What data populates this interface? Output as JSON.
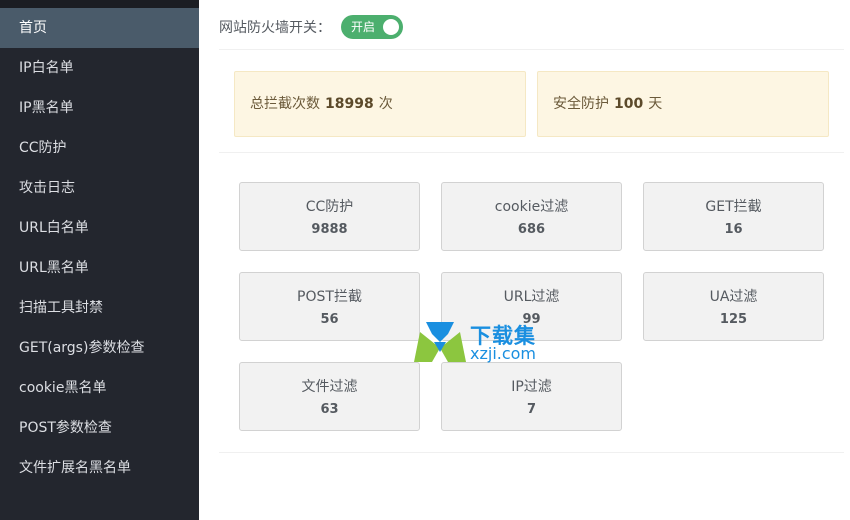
{
  "sidebar": {
    "items": [
      {
        "label": "首页",
        "active": true
      },
      {
        "label": "IP白名单"
      },
      {
        "label": "IP黑名单"
      },
      {
        "label": "CC防护"
      },
      {
        "label": "攻击日志"
      },
      {
        "label": "URL白名单"
      },
      {
        "label": "URL黑名单"
      },
      {
        "label": "扫描工具封禁"
      },
      {
        "label": "GET(args)参数检查"
      },
      {
        "label": "cookie黑名单"
      },
      {
        "label": "POST参数检查"
      },
      {
        "label": "文件扩展名黑名单"
      }
    ]
  },
  "firewall": {
    "label": "网站防火墙开关：",
    "toggle_text": "开启",
    "enabled": true
  },
  "stats": {
    "blocked_prefix": "总拦截次数",
    "blocked_count": "18998",
    "blocked_suffix": "次",
    "safe_prefix": "安全防护",
    "safe_days": "100",
    "safe_suffix": "天"
  },
  "cards": [
    {
      "title": "CC防护",
      "value": "9888"
    },
    {
      "title": "cookie过滤",
      "value": "686"
    },
    {
      "title": "GET拦截",
      "value": "16"
    },
    {
      "title": "POST拦截",
      "value": "56"
    },
    {
      "title": "URL过滤",
      "value": "99"
    },
    {
      "title": "UA过滤",
      "value": "125"
    },
    {
      "title": "文件过滤",
      "value": "63"
    },
    {
      "title": "IP过滤",
      "value": "7"
    }
  ],
  "watermark": {
    "cn": "下载集",
    "en": "xzji.com"
  },
  "colors": {
    "sidebar_bg": "#23262e",
    "sidebar_active": "#4a5b6a",
    "toggle_on": "#4caf6e",
    "stat_bg": "#fdf6e3",
    "card_bg": "#f2f2f2",
    "watermark_blue": "#1a8fe0",
    "watermark_green": "#8cc63f"
  }
}
